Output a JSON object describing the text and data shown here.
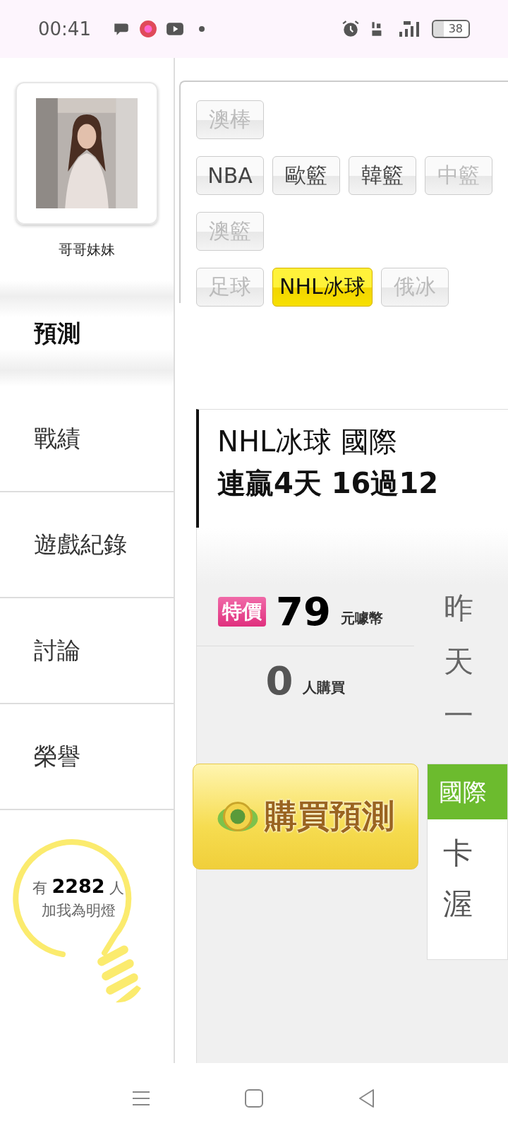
{
  "status_bar": {
    "time": "00:41",
    "battery": "38"
  },
  "profile": {
    "name": "哥哥妹妹"
  },
  "sidebar": {
    "items": [
      {
        "label": "預測",
        "selected": true
      },
      {
        "label": "戰績",
        "selected": false
      },
      {
        "label": "遊戲紀錄",
        "selected": false
      },
      {
        "label": "討論",
        "selected": false
      },
      {
        "label": "榮譽",
        "selected": false
      }
    ]
  },
  "fans": {
    "count_text": "有 **2282** 人",
    "caption": "加我為明燈"
  },
  "tag_rows": [
    [
      {
        "label": "澳棒",
        "selected": false,
        "disabled": true
      }
    ],
    [
      {
        "label": "NBA",
        "selected": false,
        "disabled": false
      },
      {
        "label": "歐籃",
        "selected": false,
        "disabled": false
      },
      {
        "label": "韓籃",
        "selected": false,
        "disabled": false
      },
      {
        "label": "中籃",
        "selected": false,
        "disabled": true
      }
    ],
    [
      {
        "label": "澳籃",
        "selected": false,
        "disabled": true
      }
    ],
    [
      {
        "label": "足球",
        "selected": false,
        "disabled": true
      },
      {
        "label": "NHL冰球",
        "selected": true,
        "disabled": false
      },
      {
        "label": "俄冰",
        "selected": false,
        "disabled": true
      }
    ]
  ],
  "card": {
    "title": "NHL冰球 國際",
    "record": "連贏4天 16過12"
  },
  "price": {
    "badge": "特價",
    "amount": "79",
    "unit": "元噱幣",
    "buyers": "0",
    "buyers_label": "人購買"
  },
  "description_lines": [
    "昨",
    "天",
    "一"
  ],
  "buy_button": {
    "label": "購買預測"
  },
  "league_box": {
    "header": "國際",
    "lines": [
      "卡",
      "渥"
    ]
  }
}
